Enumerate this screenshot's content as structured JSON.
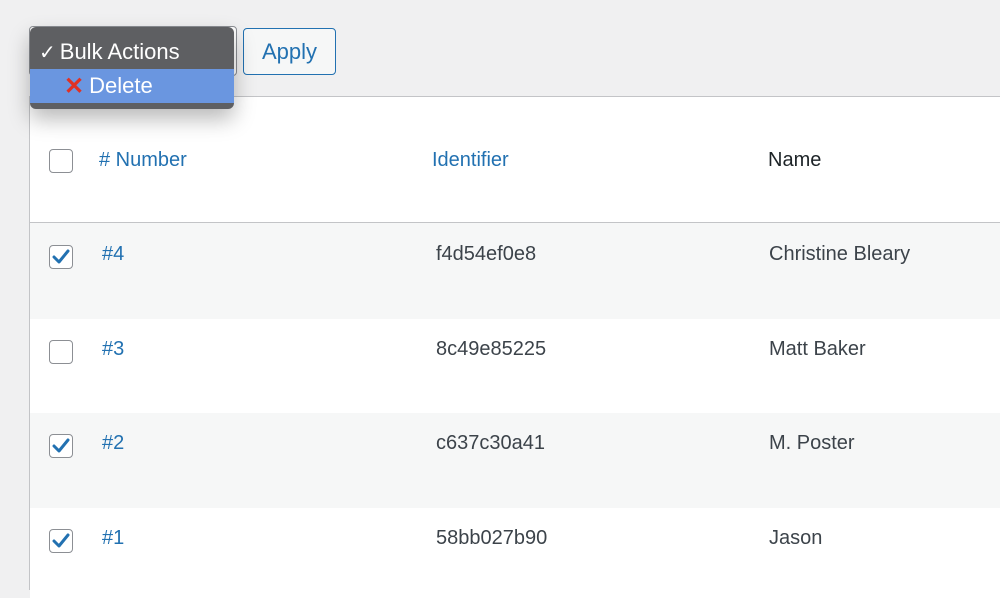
{
  "toolbar": {
    "bulk_actions": {
      "selected_label": "Bulk Actions",
      "options": [
        {
          "label": "Bulk Actions",
          "icon": "check-icon",
          "checked": true
        },
        {
          "label": "Delete",
          "icon": "cross-mark-icon",
          "highlighted": true
        }
      ]
    },
    "apply_label": "Apply"
  },
  "table": {
    "columns": [
      "# Number",
      "Identifier",
      "Name"
    ],
    "header_checked": false,
    "rows": [
      {
        "number": "#4",
        "identifier": "f4d54ef0e8",
        "name": "Christine Bleary",
        "checked": true
      },
      {
        "number": "#3",
        "identifier": "8c49e85225",
        "name": "Matt Baker",
        "checked": false
      },
      {
        "number": "#2",
        "identifier": "c637c30a41",
        "name": "M. Poster",
        "checked": true
      },
      {
        "number": "#1",
        "identifier": "58bb027b90",
        "name": "Jason",
        "checked": true
      }
    ]
  }
}
